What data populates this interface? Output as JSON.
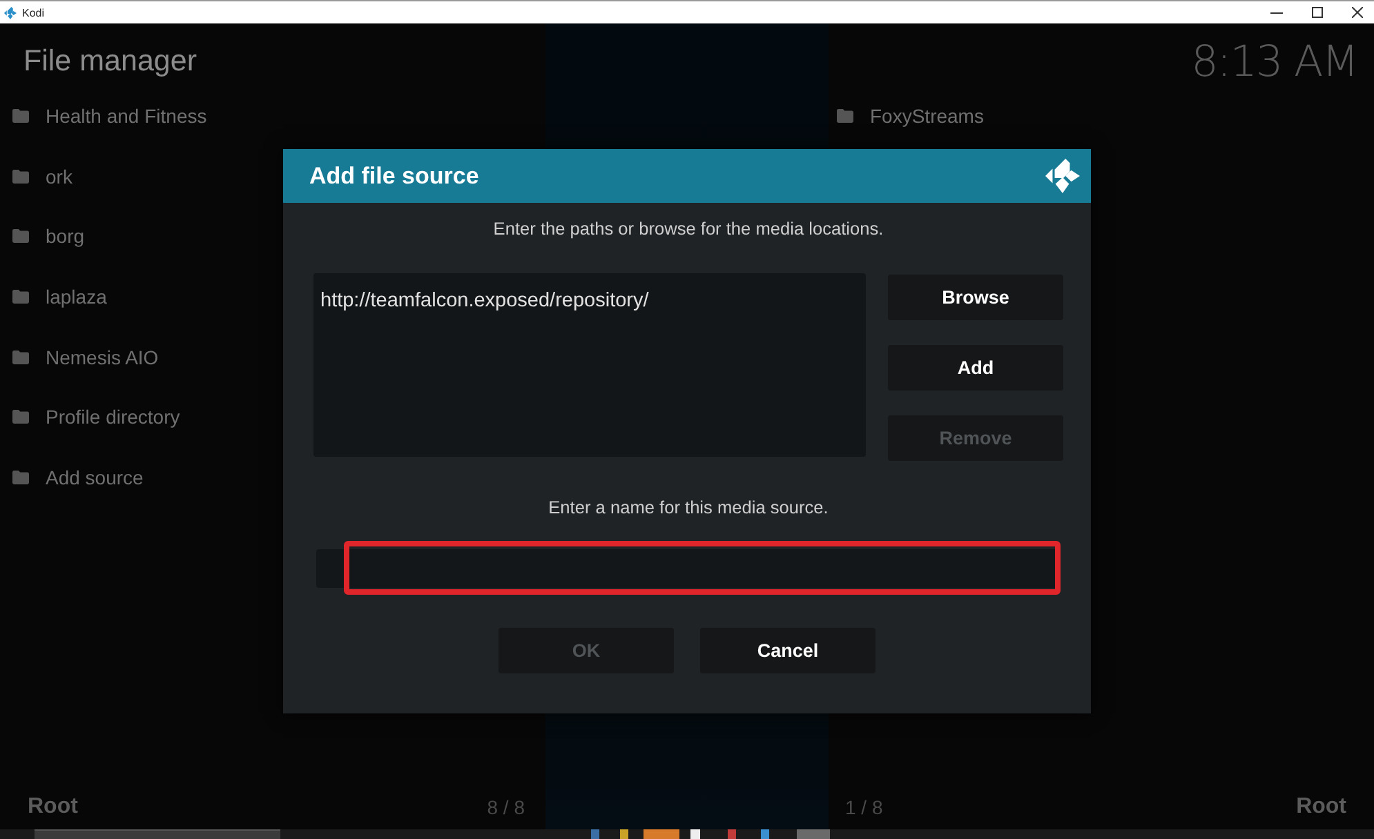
{
  "window": {
    "title": "Kodi"
  },
  "header": {
    "title": "File manager",
    "clock": "8:13 AM"
  },
  "sources_left": [
    {
      "label": "Health and Fitness"
    },
    {
      "label": "ork"
    },
    {
      "label": "borg"
    },
    {
      "label": "laplaza"
    },
    {
      "label": "Nemesis AIO"
    },
    {
      "label": "Profile directory"
    },
    {
      "label": "Add source"
    }
  ],
  "sources_right": [
    {
      "label": "FoxyStreams"
    }
  ],
  "footer": {
    "path_left": "Root",
    "count_left": "8 / 8",
    "count_right": "1 / 8",
    "path_right": "Root"
  },
  "dialog": {
    "title": "Add file source",
    "paths_prompt": "Enter the paths or browse for the media locations.",
    "paths": [
      "http://teamfalcon.exposed/repository/"
    ],
    "path_buttons": [
      {
        "label": "Browse",
        "disabled": false
      },
      {
        "label": "Add",
        "disabled": false
      },
      {
        "label": "Remove",
        "disabled": true
      }
    ],
    "name_prompt": "Enter a name for this media source.",
    "name_field": {
      "highlighted": true
    },
    "buttons": [
      {
        "label": "OK",
        "disabled": true
      },
      {
        "label": "Cancel",
        "disabled": false
      }
    ]
  }
}
